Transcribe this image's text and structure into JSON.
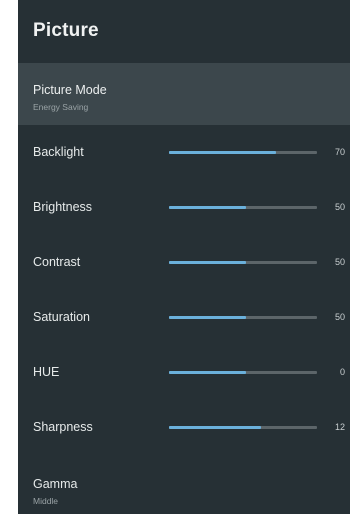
{
  "panel": {
    "title": "Picture",
    "background": "#263035"
  },
  "picture_mode": {
    "label": "Picture Mode",
    "value": "Energy Saving"
  },
  "sliders": [
    {
      "label": "Backlight",
      "value": "70",
      "level": 0.72
    },
    {
      "label": "Brightness",
      "value": "50",
      "level": 0.52
    },
    {
      "label": "Contrast",
      "value": "50",
      "level": 0.52
    },
    {
      "label": "Saturation",
      "value": "50",
      "level": 0.52
    },
    {
      "label": "HUE",
      "value": "0",
      "level": 0.52
    },
    {
      "label": "Sharpness",
      "value": "12",
      "level": 0.62
    }
  ],
  "gamma": {
    "label": "Gamma",
    "value": "Middle"
  },
  "colors": {
    "accent": "#6bb1dc",
    "track": "#5c6569",
    "selected_row": "#3c474c"
  }
}
